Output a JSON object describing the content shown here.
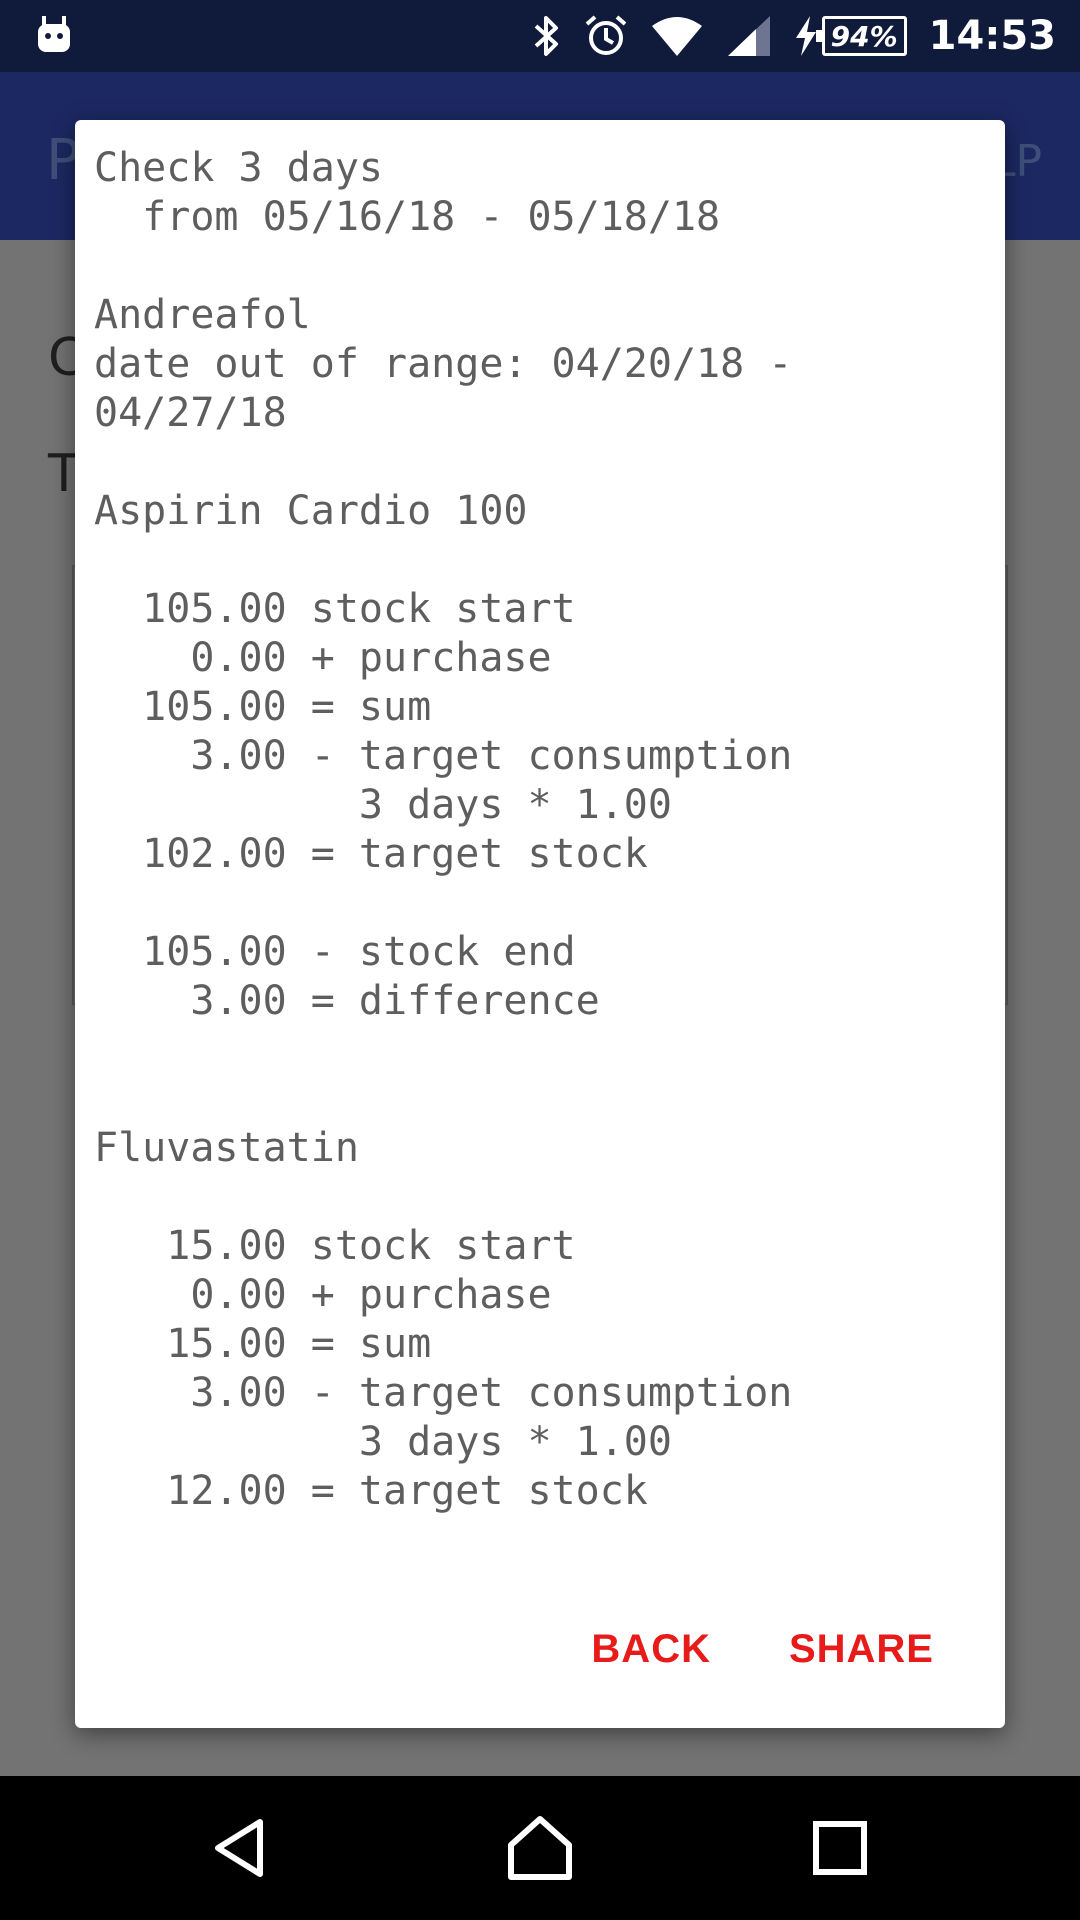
{
  "status_bar": {
    "battery_percent": "94%",
    "time": "14:53",
    "icons": [
      "android-debug-icon",
      "bluetooth-icon",
      "alarm-icon",
      "wifi-icon",
      "cell-signal-icon",
      "charging-icon",
      "battery-icon"
    ]
  },
  "background": {
    "app_bar_left_letter": "P",
    "app_bar_right_text": "LP",
    "content_letter_1": "C",
    "content_letter_2": "T"
  },
  "dialog": {
    "lines": [
      "Check 3 days",
      "  from 05/16/18 - 05/18/18",
      "",
      "Andreafol",
      "date out of range: 04/20/18 -",
      "04/27/18",
      "",
      "Aspirin Cardio 100",
      "",
      "  105.00 stock start",
      "    0.00 + purchase",
      "  105.00 = sum",
      "    3.00 - target consumption",
      "           3 days * 1.00",
      "  102.00 = target stock",
      "",
      "  105.00 - stock end",
      "    3.00 = difference",
      "",
      "",
      "Fluvastatin",
      "",
      "   15.00 stock start",
      "    0.00 + purchase",
      "   15.00 = sum",
      "    3.00 - target consumption",
      "           3 days * 1.00",
      "   12.00 = target stock"
    ],
    "back_label": "BACK",
    "share_label": "SHARE",
    "accent_color": "#e81b1b"
  },
  "nav_bar": {
    "buttons": [
      "back-nav",
      "home-nav",
      "recents-nav"
    ]
  }
}
